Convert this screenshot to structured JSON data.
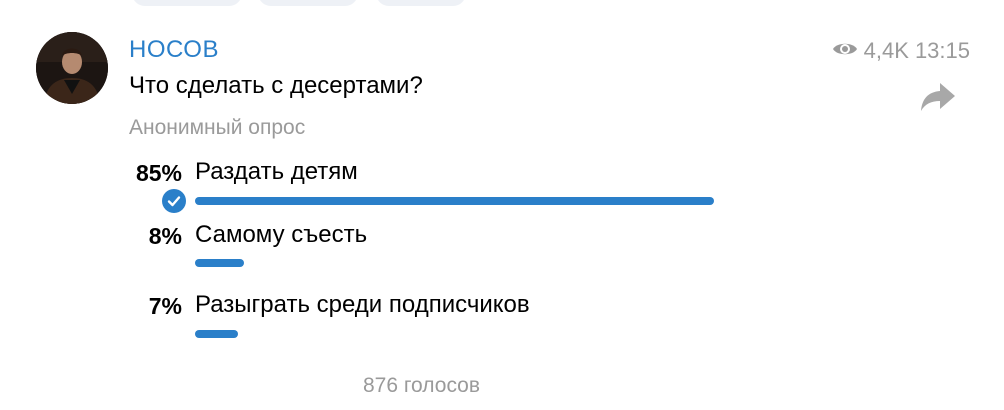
{
  "post": {
    "channel_name": "НОСОВ",
    "views": "4,4K",
    "time": "13:15",
    "question": "Что сделать с десертами?"
  },
  "poll": {
    "type_label": "Анонимный опрос",
    "options": [
      {
        "percent_label": "85%",
        "label": "Раздать детям",
        "fraction": 0.85,
        "chosen": true
      },
      {
        "percent_label": "8%",
        "label": "Самому съесть",
        "fraction": 0.08,
        "chosen": false
      },
      {
        "percent_label": "7%",
        "label": "Разыграть среди подписчиков",
        "fraction": 0.07,
        "chosen": false
      }
    ],
    "votes_label": "876 голосов"
  },
  "colors": {
    "accent": "#2a7fc9",
    "muted": "#9a9a9a"
  },
  "icons": {
    "views": "eye-icon",
    "share": "share-arrow-icon",
    "chosen": "check-circle-icon"
  }
}
